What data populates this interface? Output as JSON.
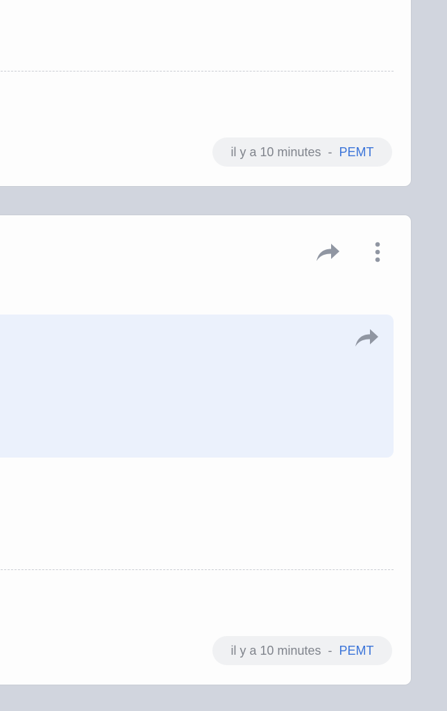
{
  "cards": [
    {
      "meta": {
        "time": "il y a 10 minutes",
        "separator": "-",
        "author": "PEMT"
      }
    },
    {
      "meta": {
        "time": "il y a 10 minutes",
        "separator": "-",
        "author": "PEMT"
      },
      "icons": {
        "share": "share-arrow-icon",
        "more": "more-vertical-icon",
        "quote_share": "share-arrow-icon"
      }
    }
  ],
  "colors": {
    "background": "#d1d5de",
    "card": "#fdfdfd",
    "quote_background": "#ebf1fc",
    "author_link": "#3b74d9",
    "muted_text": "#80848c",
    "icon": "#9096a2"
  }
}
